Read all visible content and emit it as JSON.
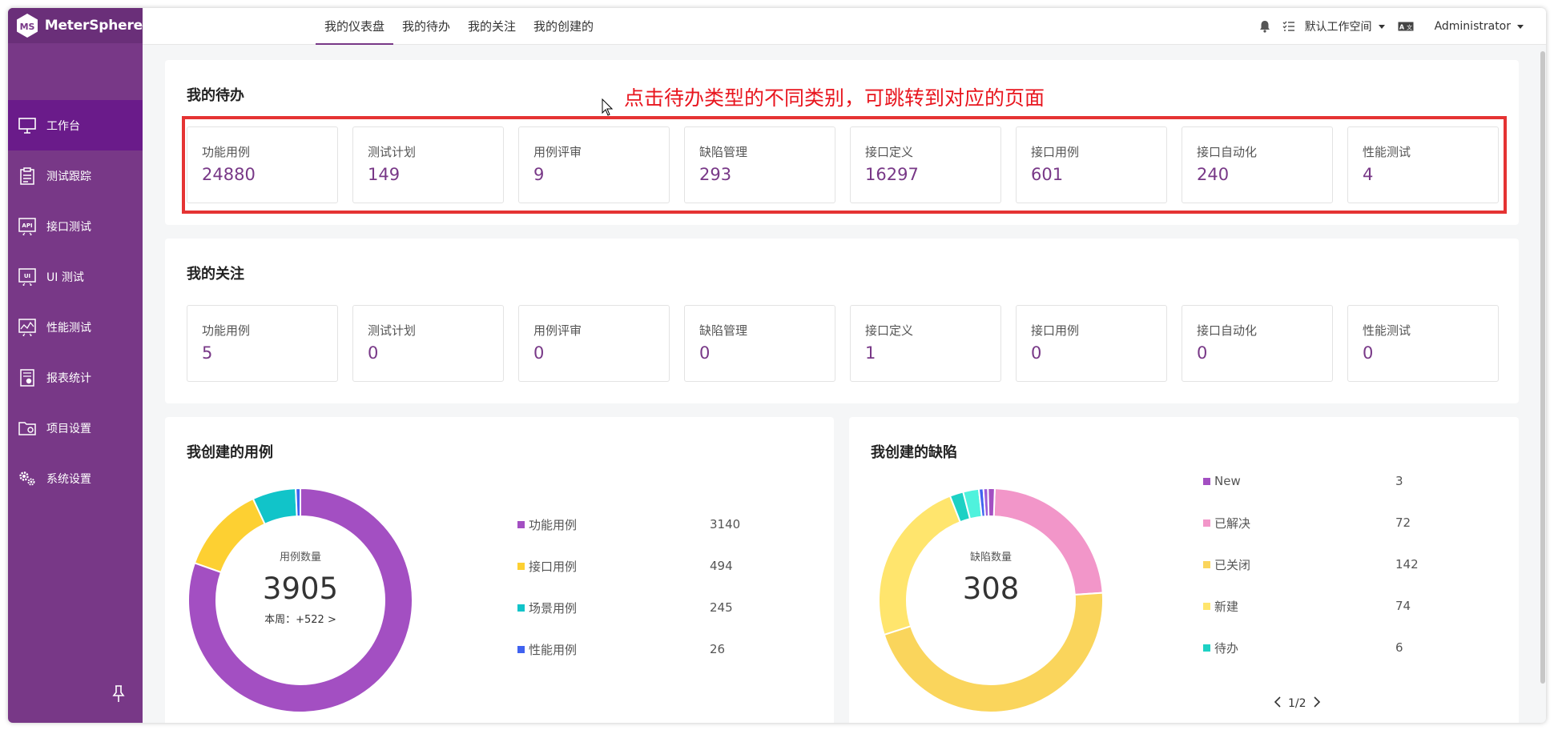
{
  "app": {
    "name": "MeterSphere",
    "logo_letters": "MS"
  },
  "sidebar": {
    "items": [
      {
        "label": "工作台",
        "icon": "monitor-icon",
        "active": true
      },
      {
        "label": "测试跟踪",
        "icon": "clipboard-icon",
        "active": false
      },
      {
        "label": "接口测试",
        "icon": "api-icon",
        "active": false
      },
      {
        "label": "UI 测试",
        "icon": "ui-test-icon",
        "active": false
      },
      {
        "label": "性能测试",
        "icon": "performance-icon",
        "active": false
      },
      {
        "label": "报表统计",
        "icon": "report-icon",
        "active": false
      },
      {
        "label": "项目设置",
        "icon": "folder-settings-icon",
        "active": false
      },
      {
        "label": "系统设置",
        "icon": "gears-icon",
        "active": false
      }
    ]
  },
  "header": {
    "tabs": [
      {
        "label": "我的仪表盘",
        "active": true
      },
      {
        "label": "我的待办",
        "active": false
      },
      {
        "label": "我的关注",
        "active": false
      },
      {
        "label": "我的创建的",
        "active": false
      }
    ],
    "workspace": "默认工作空间",
    "user": "Administrator"
  },
  "todo": {
    "title": "我的待办",
    "annotation": "点击待办类型的不同类别，可跳转到对应的页面",
    "stats": [
      {
        "label": "功能用例",
        "value": "24880"
      },
      {
        "label": "测试计划",
        "value": "149"
      },
      {
        "label": "用例评审",
        "value": "9"
      },
      {
        "label": "缺陷管理",
        "value": "293"
      },
      {
        "label": "接口定义",
        "value": "16297"
      },
      {
        "label": "接口用例",
        "value": "601"
      },
      {
        "label": "接口自动化",
        "value": "240"
      },
      {
        "label": "性能测试",
        "value": "4"
      }
    ]
  },
  "follow": {
    "title": "我的关注",
    "stats": [
      {
        "label": "功能用例",
        "value": "5"
      },
      {
        "label": "测试计划",
        "value": "0"
      },
      {
        "label": "用例评审",
        "value": "0"
      },
      {
        "label": "缺陷管理",
        "value": "0"
      },
      {
        "label": "接口定义",
        "value": "1"
      },
      {
        "label": "接口用例",
        "value": "0"
      },
      {
        "label": "接口自动化",
        "value": "0"
      },
      {
        "label": "性能测试",
        "value": "0"
      }
    ]
  },
  "cases_card": {
    "title": "我创建的用例",
    "center_label": "用例数量",
    "center_value": "3905",
    "week_label": "本周：+522 >"
  },
  "bugs_card": {
    "title": "我创建的缺陷",
    "center_label": "缺陷数量",
    "center_value": "308",
    "pager": "1/2"
  },
  "chart_data": [
    {
      "type": "pie",
      "title": "我创建的用例",
      "categories": [
        "功能用例",
        "接口用例",
        "场景用例",
        "性能用例"
      ],
      "values": [
        3140,
        494,
        245,
        26
      ],
      "colors": [
        "#a34fc2",
        "#fdd032",
        "#11c4c9",
        "#4062f0"
      ]
    },
    {
      "type": "pie",
      "title": "我创建的缺陷",
      "categories": [
        "New",
        "已解决",
        "已关闭",
        "新建",
        "待办"
      ],
      "values": [
        3,
        72,
        142,
        74,
        6
      ],
      "colors": [
        "#a34fc2",
        "#f296c9",
        "#fad55c",
        "#ffe56d",
        "#1dd1c4"
      ],
      "extra_segments": [
        {
          "value": 7,
          "color": "#4ff2dd"
        },
        {
          "value": 2,
          "color": "#4062f0"
        },
        {
          "value": 2,
          "color": "#9c5cd8"
        }
      ]
    }
  ]
}
